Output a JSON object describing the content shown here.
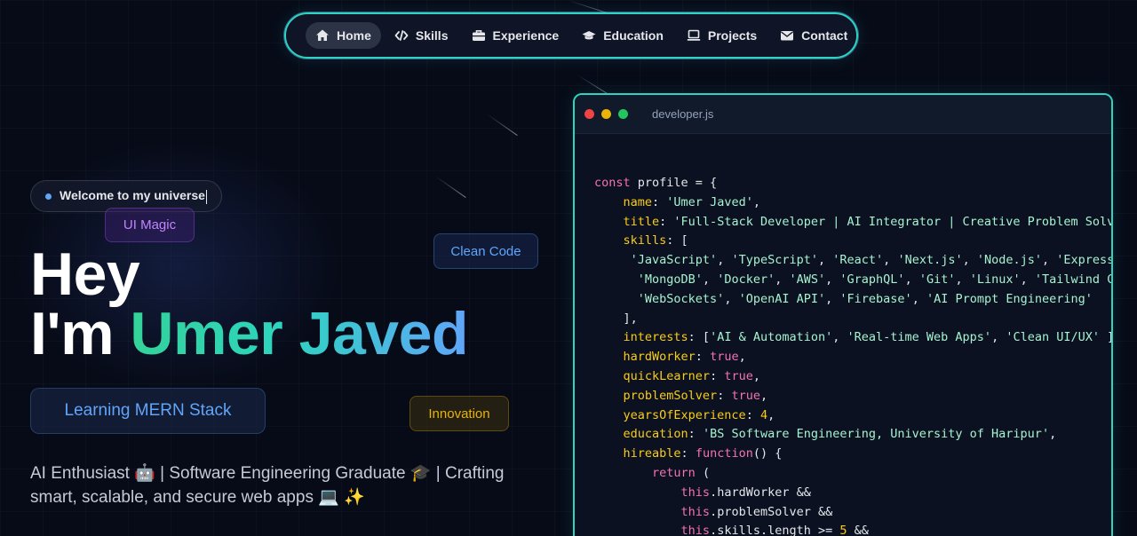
{
  "nav": {
    "items": [
      {
        "label": "Home",
        "icon": "home-icon",
        "active": true
      },
      {
        "label": "Skills",
        "icon": "code-icon",
        "active": false
      },
      {
        "label": "Experience",
        "icon": "briefcase-icon",
        "active": false
      },
      {
        "label": "Education",
        "icon": "graduation-cap-icon",
        "active": false
      },
      {
        "label": "Projects",
        "icon": "laptop-icon",
        "active": false
      },
      {
        "label": "Contact",
        "icon": "envelope-icon",
        "active": false
      }
    ]
  },
  "hero": {
    "welcome": "Welcome to my universe",
    "greeting": "Hey",
    "intro_prefix": "I'm ",
    "name": "Umer Javed",
    "role": "Learning MERN Stack",
    "bio": "AI Enthusiast 🤖 | Software Engineering Graduate 🎓 | Crafting smart, scalable, and secure web apps 💻 ✨",
    "floating_tags": {
      "ui_magic": "UI Magic",
      "clean_code": "Clean Code",
      "innovation": "Innovation"
    }
  },
  "code_window": {
    "filename": "developer.js",
    "lines": [
      {
        "indent": 0,
        "tokens": [
          [
            "k",
            "const "
          ],
          [
            "x",
            "profile = {"
          ]
        ]
      },
      {
        "indent": 4,
        "tokens": [
          [
            "p",
            "name"
          ],
          [
            "x",
            ": "
          ],
          [
            "s",
            "'Umer Javed'"
          ],
          [
            "x",
            ","
          ]
        ]
      },
      {
        "indent": 4,
        "tokens": [
          [
            "p",
            "title"
          ],
          [
            "x",
            ": "
          ],
          [
            "s",
            "'Full-Stack Developer | AI Integrator | Creative Problem Solver'"
          ],
          [
            "x",
            ","
          ]
        ]
      },
      {
        "indent": 4,
        "tokens": [
          [
            "p",
            "skills"
          ],
          [
            "x",
            ": ["
          ]
        ]
      },
      {
        "indent": 5,
        "tokens": [
          [
            "s",
            "'JavaScript'"
          ],
          [
            "x",
            ", "
          ],
          [
            "s",
            "'TypeScript'"
          ],
          [
            "x",
            ", "
          ],
          [
            "s",
            "'React'"
          ],
          [
            "x",
            ", "
          ],
          [
            "s",
            "'Next.js'"
          ],
          [
            "x",
            ", "
          ],
          [
            "s",
            "'Node.js'"
          ],
          [
            "x",
            ", "
          ],
          [
            "s",
            "'Express.js'"
          ],
          [
            "x",
            ","
          ]
        ]
      },
      {
        "indent": 6,
        "tokens": [
          [
            "s",
            "'MongoDB'"
          ],
          [
            "x",
            ", "
          ],
          [
            "s",
            "'Docker'"
          ],
          [
            "x",
            ", "
          ],
          [
            "s",
            "'AWS'"
          ],
          [
            "x",
            ", "
          ],
          [
            "s",
            "'GraphQL'"
          ],
          [
            "x",
            ", "
          ],
          [
            "s",
            "'Git'"
          ],
          [
            "x",
            ", "
          ],
          [
            "s",
            "'Linux'"
          ],
          [
            "x",
            ", "
          ],
          [
            "s",
            "'Tailwind CSS'"
          ],
          [
            "x",
            ","
          ]
        ]
      },
      {
        "indent": 6,
        "tokens": [
          [
            "s",
            "'WebSockets'"
          ],
          [
            "x",
            ", "
          ],
          [
            "s",
            "'OpenAI API'"
          ],
          [
            "x",
            ", "
          ],
          [
            "s",
            "'Firebase'"
          ],
          [
            "x",
            ", "
          ],
          [
            "s",
            "'AI Prompt Engineering'"
          ]
        ]
      },
      {
        "indent": 4,
        "tokens": [
          [
            "x",
            "],"
          ]
        ]
      },
      {
        "indent": 4,
        "tokens": [
          [
            "p",
            "interests"
          ],
          [
            "x",
            ": ["
          ],
          [
            "s",
            "'AI & Automation'"
          ],
          [
            "x",
            ", "
          ],
          [
            "s",
            "'Real-time Web Apps'"
          ],
          [
            "x",
            ", "
          ],
          [
            "s",
            "'Clean UI/UX'"
          ],
          [
            "x",
            " ],"
          ]
        ]
      },
      {
        "indent": 4,
        "tokens": [
          [
            "p",
            "hardWorker"
          ],
          [
            "x",
            ": "
          ],
          [
            "b",
            "true"
          ],
          [
            "x",
            ","
          ]
        ]
      },
      {
        "indent": 4,
        "tokens": [
          [
            "p",
            "quickLearner"
          ],
          [
            "x",
            ": "
          ],
          [
            "b",
            "true"
          ],
          [
            "x",
            ","
          ]
        ]
      },
      {
        "indent": 4,
        "tokens": [
          [
            "p",
            "problemSolver"
          ],
          [
            "x",
            ": "
          ],
          [
            "b",
            "true"
          ],
          [
            "x",
            ","
          ]
        ]
      },
      {
        "indent": 4,
        "tokens": [
          [
            "p",
            "yearsOfExperience"
          ],
          [
            "x",
            ": "
          ],
          [
            "n",
            "4"
          ],
          [
            "x",
            ","
          ]
        ]
      },
      {
        "indent": 4,
        "tokens": [
          [
            "p",
            "education"
          ],
          [
            "x",
            ": "
          ],
          [
            "s",
            "'BS Software Engineering, University of Haripur'"
          ],
          [
            "x",
            ","
          ]
        ]
      },
      {
        "indent": 4,
        "tokens": [
          [
            "p",
            "hireable"
          ],
          [
            "x",
            ": "
          ],
          [
            "k",
            "function"
          ],
          [
            "x",
            "() {"
          ]
        ]
      },
      {
        "indent": 8,
        "tokens": [
          [
            "k",
            "return"
          ],
          [
            "x",
            " ("
          ]
        ]
      },
      {
        "indent": 12,
        "tokens": [
          [
            "t",
            "this"
          ],
          [
            "x",
            ".hardWorker &&"
          ]
        ]
      },
      {
        "indent": 12,
        "tokens": [
          [
            "t",
            "this"
          ],
          [
            "x",
            ".problemSolver &&"
          ]
        ]
      },
      {
        "indent": 12,
        "tokens": [
          [
            "t",
            "this"
          ],
          [
            "x",
            ".skills.length >= "
          ],
          [
            "n",
            "5"
          ],
          [
            "x",
            " &&"
          ]
        ]
      }
    ]
  },
  "colors": {
    "accent_teal": "#2dd4bf",
    "accent_blue": "#60a5fa",
    "accent_green": "#34d399",
    "background": "#070b18"
  }
}
